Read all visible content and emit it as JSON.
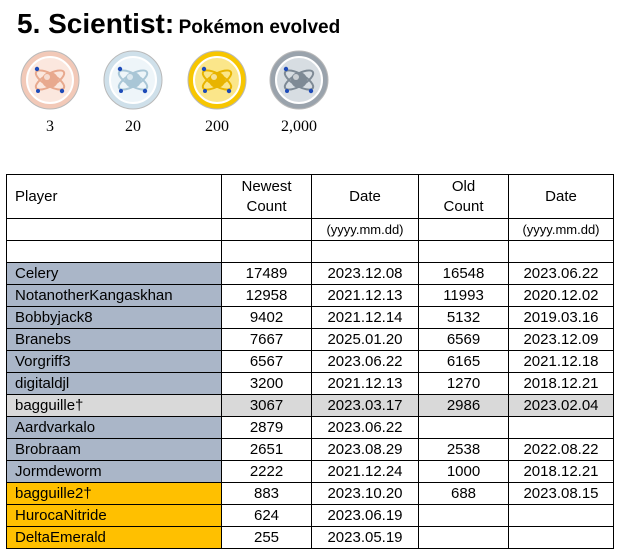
{
  "header": {
    "title": "5. Scientist:",
    "subtitle": "Pokémon evolved"
  },
  "medals": [
    {
      "label": "3",
      "icon": "bronze-medal-icon",
      "ring": "#f2c9b8",
      "inner": "#fbe7de",
      "fill": "#e8a98e"
    },
    {
      "label": "20",
      "icon": "silver-medal-icon",
      "ring": "#cfe0ea",
      "inner": "#eef5f9",
      "fill": "#a9c6d6"
    },
    {
      "label": "200",
      "icon": "gold-medal-icon",
      "ring": "#f7c600",
      "inner": "#fbe68a",
      "fill": "#e8b400"
    },
    {
      "label": "2,000",
      "icon": "platinum-medal-icon",
      "ring": "#9aa3ac",
      "inner": "#d7dde2",
      "fill": "#7e8a95"
    }
  ],
  "table": {
    "headers": {
      "player": "Player",
      "newest_line1": "Newest",
      "newest_line2": "Count",
      "date": "Date",
      "old_line1": "Old",
      "old_line2": "Count",
      "date2": "Date"
    },
    "date_format": "(yyyy.mm.dd)",
    "rows": [
      {
        "player": "Celery",
        "newest": "17489",
        "date": "2023.12.08",
        "old": "16548",
        "date2": "2023.06.22",
        "style": "blue"
      },
      {
        "player": "NotanotherKangaskhan",
        "newest": "12958",
        "date": "2021.12.13",
        "old": "11993",
        "date2": "2020.12.02",
        "style": "blue"
      },
      {
        "player": "Bobbyjack8",
        "newest": "9402",
        "date": "2021.12.14",
        "old": "5132",
        "date2": "2019.03.16",
        "style": "blue"
      },
      {
        "player": "Branebs",
        "newest": "7667",
        "date": "2025.01.20",
        "old": "6569",
        "date2": "2023.12.09",
        "style": "blue"
      },
      {
        "player": "Vorgriff3",
        "newest": "6567",
        "date": "2023.06.22",
        "old": "6165",
        "date2": "2021.12.18",
        "style": "blue"
      },
      {
        "player": "digitaldjl",
        "newest": "3200",
        "date": "2021.12.13",
        "old": "1270",
        "date2": "2018.12.21",
        "style": "blue"
      },
      {
        "player": "bagguille†",
        "newest": "3067",
        "date": "2023.03.17",
        "old": "2986",
        "date2": "2023.02.04",
        "style": "gray"
      },
      {
        "player": "Aardvarkalo",
        "newest": "2879",
        "date": "2023.06.22",
        "old": "",
        "date2": "",
        "style": "blue"
      },
      {
        "player": "Brobraam",
        "newest": "2651",
        "date": "2023.08.29",
        "old": "2538",
        "date2": "2022.08.22",
        "style": "blue"
      },
      {
        "player": "Jormdeworm",
        "newest": "2222",
        "date": "2021.12.24",
        "old": "1000",
        "date2": "2018.12.21",
        "style": "blue"
      },
      {
        "player": "bagguille2†",
        "newest": "883",
        "date": "2023.10.20",
        "old": "688",
        "date2": "2023.08.15",
        "style": "orange"
      },
      {
        "player": "HurocaNitride",
        "newest": "624",
        "date": "2023.06.19",
        "old": "",
        "date2": "",
        "style": "orange"
      },
      {
        "player": "DeltaEmerald",
        "newest": "255",
        "date": "2023.05.19",
        "old": "",
        "date2": "",
        "style": "orange"
      }
    ]
  }
}
